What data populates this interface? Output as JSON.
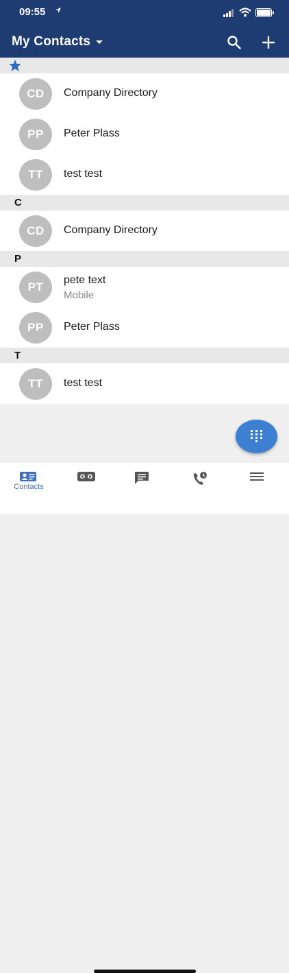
{
  "status_bar": {
    "time": "09:55",
    "location_arrow": "location-arrow-icon"
  },
  "app_bar": {
    "title": "My Contacts",
    "search_icon": "search-icon",
    "add_icon": "plus-icon"
  },
  "sections": [
    {
      "header": "",
      "header_icon": "star-icon",
      "contacts": [
        {
          "initials": "CD",
          "name": "Company Directory"
        },
        {
          "initials": "PP",
          "name": "Peter Plass"
        },
        {
          "initials": "TT",
          "name": "test test"
        }
      ]
    },
    {
      "header": "C",
      "contacts": [
        {
          "initials": "CD",
          "name": "Company Directory"
        }
      ]
    },
    {
      "header": "P",
      "contacts": [
        {
          "initials": "PT",
          "name": "pete text",
          "subtitle": "Mobile"
        },
        {
          "initials": "PP",
          "name": "Peter Plass"
        }
      ]
    },
    {
      "header": "T",
      "contacts": [
        {
          "initials": "TT",
          "name": "test test"
        }
      ]
    }
  ],
  "fab": {
    "icon": "dialpad-icon"
  },
  "tab_bar": [
    {
      "label": "Contacts",
      "icon": "contacts-card-icon",
      "active": true
    },
    {
      "label": "",
      "icon": "voicemail-icon"
    },
    {
      "label": "",
      "icon": "message-icon"
    },
    {
      "label": "",
      "icon": "call-history-icon"
    },
    {
      "label": "",
      "icon": "menu-icon"
    }
  ],
  "colors": {
    "primary": "#1e3b72",
    "accent": "#3d7fd0",
    "avatar": "#bebebe",
    "section": "#e8e8e9",
    "background": "#efeff0"
  }
}
